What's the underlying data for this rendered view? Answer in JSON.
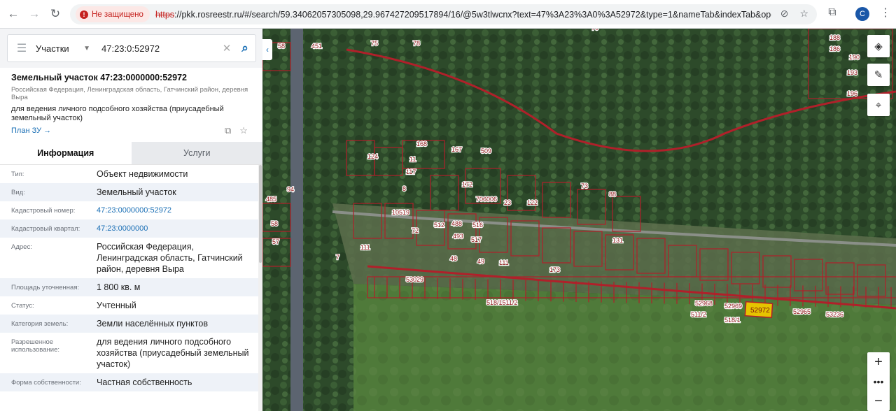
{
  "browser": {
    "security_label": "Не защищено",
    "url_scheme": "https",
    "url_rest": "://pkk.rosreestr.ru/#/search/59.34062057305098,29.967427209517894/16/@5w3tlwcnx?text=47%3A23%3A0%3A52972&type=1&nameTab&indexTab&opened=47%3...",
    "profile_initial": "C"
  },
  "search": {
    "type_label": "Участки",
    "query": "47:23:0:52972"
  },
  "object": {
    "title": "Земельный участок 47:23:0000000:52972",
    "address_short": "Российская Федерация, Ленинградская область, Гатчинский район, деревня Выра",
    "use": "для ведения личного подсобного хозяйства (приусадебный земельный участок)",
    "plan_link": "План ЗУ →"
  },
  "tabs": [
    {
      "label": "Информация"
    },
    {
      "label": "Услуги"
    }
  ],
  "info_rows": [
    {
      "key": "Тип:",
      "value": "Объект недвижимости"
    },
    {
      "key": "Вид:",
      "value": "Земельный участок"
    },
    {
      "key": "Кадастровый номер:",
      "value": "47:23:0000000:52972"
    },
    {
      "key": "Кадастровый квартал:",
      "value": "47:23:0000000"
    },
    {
      "key": "Адрес:",
      "value": "Российская Федерация, Ленинградская область, Гатчинский район, деревня Выра"
    },
    {
      "key": "Площадь уточненная:",
      "value": "1 800 кв. м"
    },
    {
      "key": "Статус:",
      "value": "Учтенный"
    },
    {
      "key": "Категория земель:",
      "value": "Земли населённых пунктов"
    },
    {
      "key": "Разрешенное использование:",
      "value": "для ведения личного подсобного хозяйства (приусадебный земельный участок)"
    },
    {
      "key": "Форма собственности:",
      "value": "Частная собственность"
    }
  ],
  "map": {
    "highlight_label": "52972",
    "parcel_labels": [
      "58",
      "451",
      "75",
      "78",
      "70",
      "188",
      "186",
      "190",
      "193",
      "196",
      "168",
      "167",
      "509",
      "124",
      "11",
      "117",
      "8",
      "94",
      "172",
      "706006",
      "23",
      "122",
      "73",
      "88",
      "485",
      "10519",
      "72",
      "512",
      "488",
      "516",
      "493",
      "517",
      "58",
      "57",
      "111",
      "7",
      "48",
      "49",
      "111",
      "173",
      "131",
      "53029",
      "518/1511/2",
      "52968",
      "52969",
      "52965",
      "53236",
      "511/2",
      "518/1"
    ],
    "colors": {
      "parcel_border": "#b0202a",
      "highlight_fill": "#e6c400",
      "label_bg": "#ffffff"
    }
  }
}
